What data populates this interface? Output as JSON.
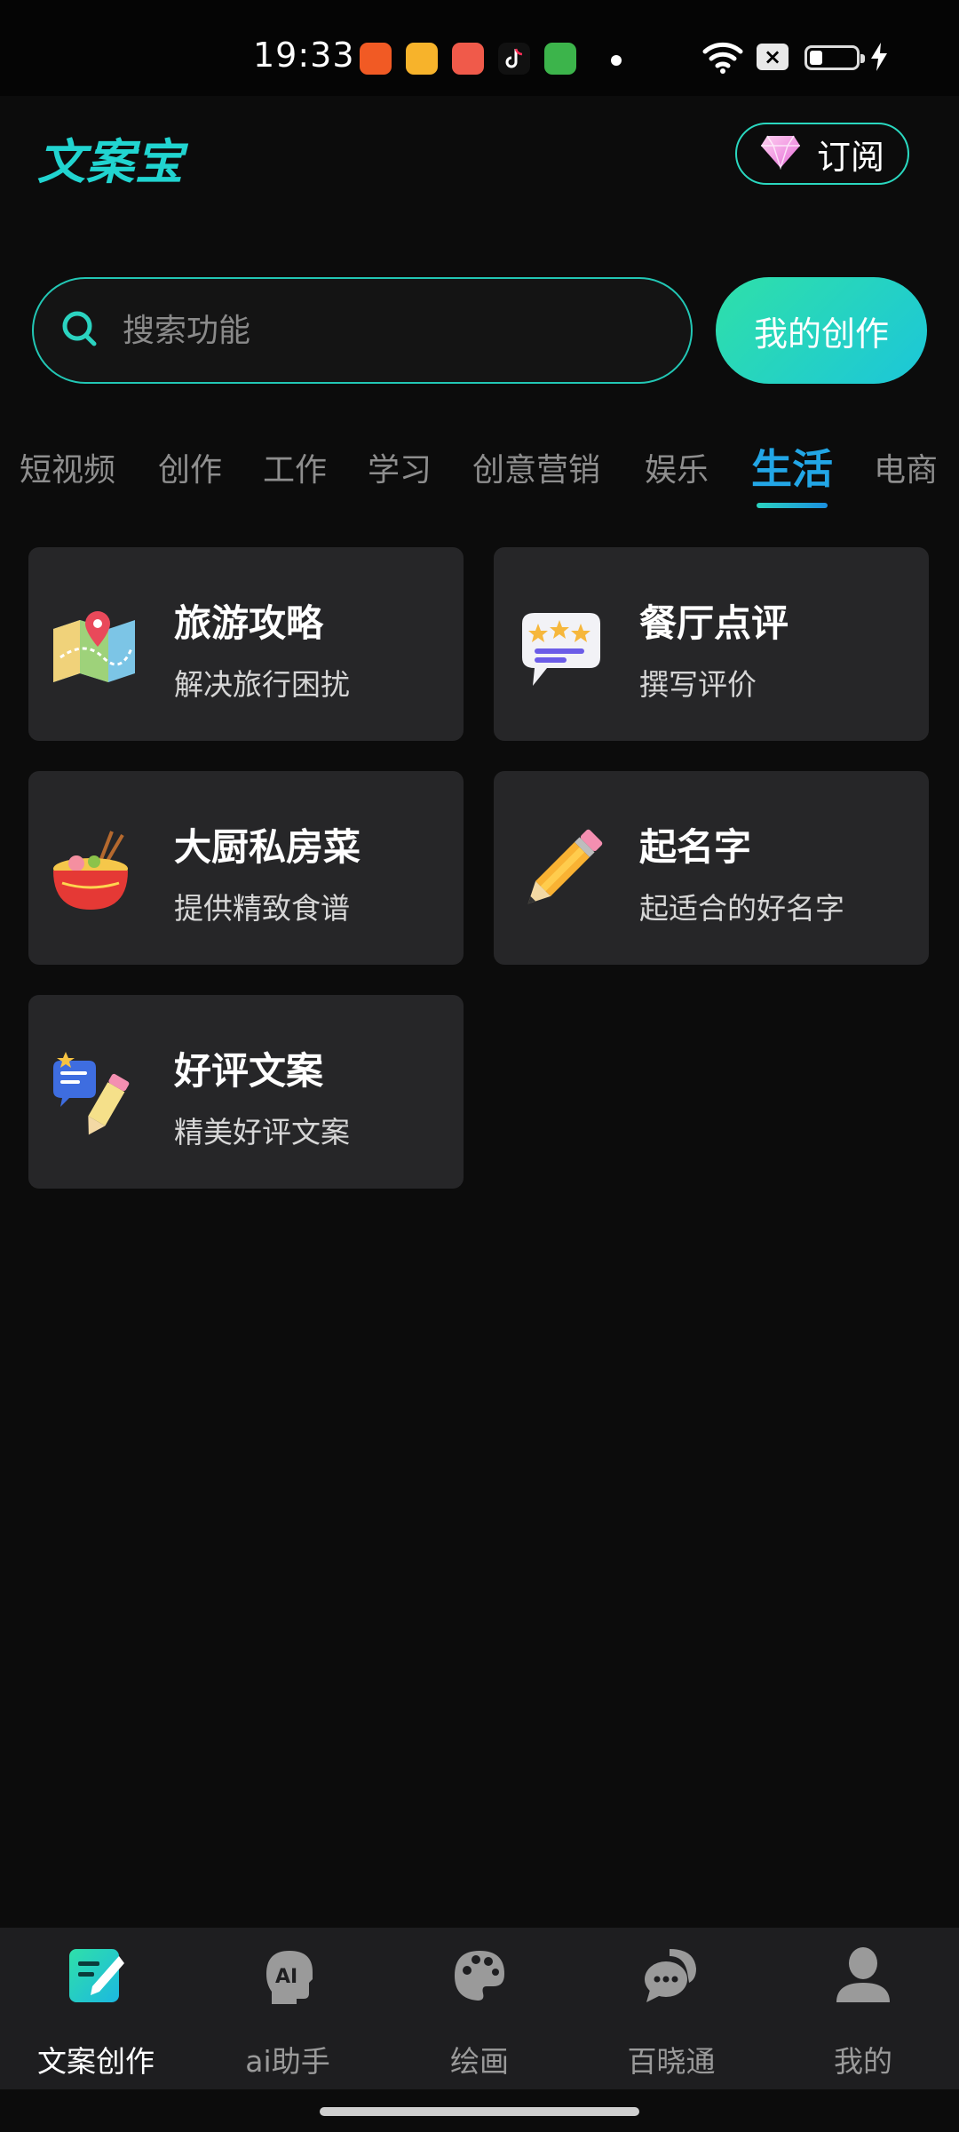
{
  "status_bar": {
    "time": "19:33"
  },
  "header": {
    "logo": "文案宝",
    "subscribe_label": "订阅"
  },
  "search": {
    "placeholder": "搜索功能"
  },
  "my_creation_label": "我的创作",
  "tabs": [
    "短视频",
    "创作",
    "工作",
    "学习",
    "创意营销",
    "娱乐",
    "生活",
    "电商"
  ],
  "active_tab": "生活",
  "cards": [
    {
      "title": "旅游攻略",
      "subtitle": "解决旅行困扰",
      "icon": "map-icon"
    },
    {
      "title": "餐厅点评",
      "subtitle": "撰写评价",
      "icon": "review-bubble-icon"
    },
    {
      "title": "大厨私房菜",
      "subtitle": "提供精致食谱",
      "icon": "noodle-bowl-icon"
    },
    {
      "title": "起名字",
      "subtitle": "起适合的好名字",
      "icon": "pencil-icon"
    },
    {
      "title": "好评文案",
      "subtitle": "精美好评文案",
      "icon": "praise-pencil-icon"
    }
  ],
  "bottom_nav": [
    {
      "label": "文案创作",
      "icon": "edit-doc-icon",
      "active": true
    },
    {
      "label": "ai助手",
      "icon": "ai-head-icon",
      "active": false
    },
    {
      "label": "绘画",
      "icon": "palette-icon",
      "active": false
    },
    {
      "label": "百晓通",
      "icon": "chat-bubbles-icon",
      "active": false
    },
    {
      "label": "我的",
      "icon": "person-icon",
      "active": false
    }
  ],
  "colors": {
    "accent": "#22a6e6",
    "brand": "#21d4d0",
    "card_bg": "#262628"
  }
}
